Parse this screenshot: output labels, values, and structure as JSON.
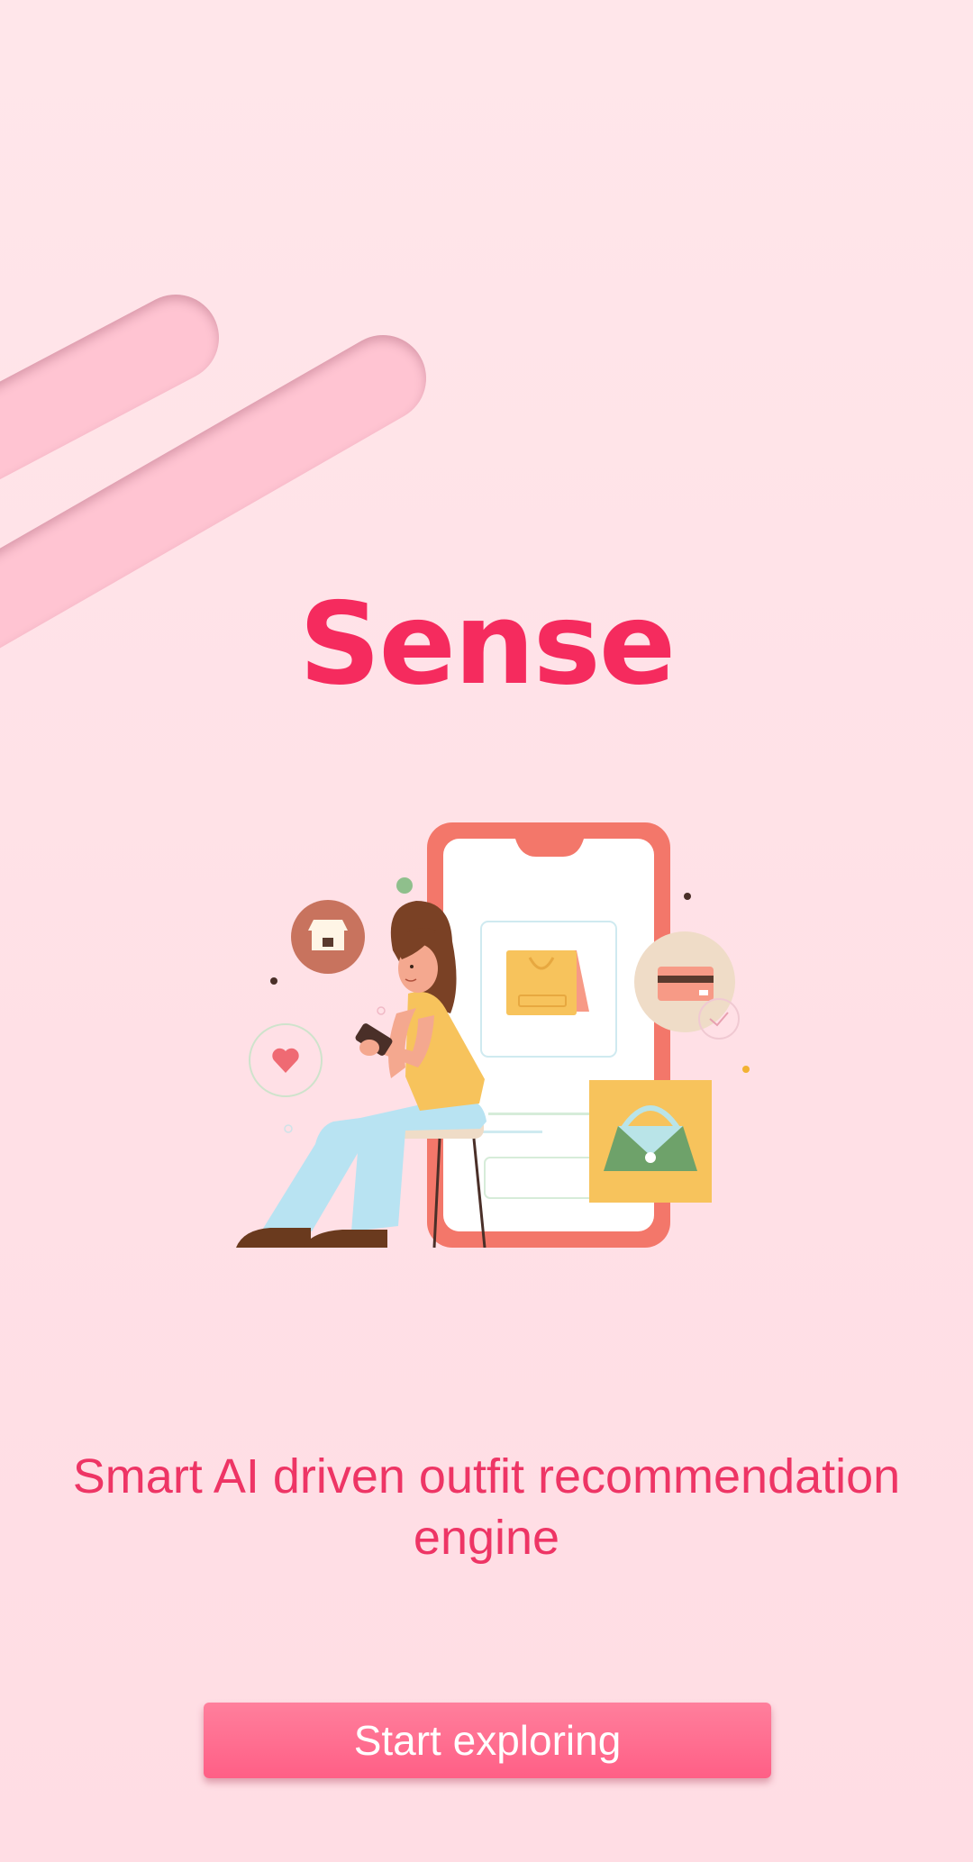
{
  "app": {
    "title": "Sense",
    "tagline": "Smart AI driven outfit recommendation engine",
    "cta_label": "Start exploring"
  },
  "colors": {
    "background": "#ffe4e9",
    "accent": "#f52b5e",
    "tagline": "#ee3565",
    "button": "#ff6f91",
    "decor_stripe": "#ffc4d2"
  },
  "illustration": {
    "icons": [
      "storefront-icon",
      "heart-icon",
      "shopping-bag-icon",
      "credit-card-icon",
      "handbag-icon",
      "check-icon"
    ]
  }
}
